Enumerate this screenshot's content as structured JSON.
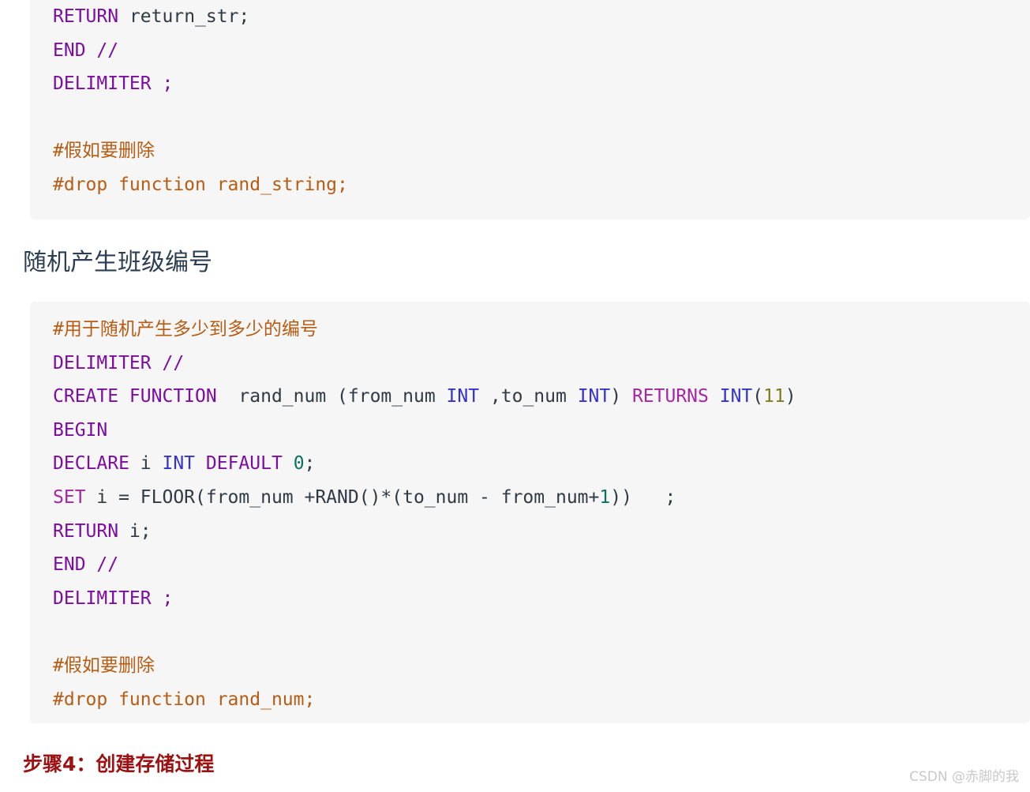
{
  "document": {
    "background_color": "#ffffff",
    "code_block_background": "#f6f6f6",
    "heading_color": "#2c3e50",
    "red_heading_color": "#9c1212",
    "comment_color": "#b85c14",
    "keyword_color": "#7c0da0",
    "type_color": "#3333cc",
    "number_color": "#0b7261",
    "watermark_color": "#c9c9c9"
  },
  "code_block_1": {
    "language": "sql",
    "lines": [
      {
        "tokens": [
          {
            "t": "RETURN",
            "c": "kw"
          },
          {
            "t": " ",
            "c": "plain"
          },
          {
            "t": "return_str;",
            "c": "plain"
          }
        ]
      },
      {
        "tokens": [
          {
            "t": "END",
            "c": "kw"
          },
          {
            "t": " ",
            "c": "plain"
          },
          {
            "t": "//",
            "c": "kw"
          }
        ]
      },
      {
        "tokens": [
          {
            "t": "DELIMITER",
            "c": "kw"
          },
          {
            "t": " ;",
            "c": "kw"
          }
        ]
      },
      {
        "tokens": []
      },
      {
        "tokens": [
          {
            "t": "#假如要删除",
            "c": "cmt"
          }
        ]
      },
      {
        "tokens": [
          {
            "t": "#drop function rand_string;",
            "c": "cmt"
          }
        ]
      }
    ],
    "plain_text": "RETURN return_str;\nEND //\nDELIMITER ;\n\n#假如要删除\n#drop function rand_string;"
  },
  "section_heading": {
    "text": "随机产生班级编号"
  },
  "code_block_2": {
    "language": "sql",
    "lines": [
      {
        "tokens": [
          {
            "t": "#用于随机产生多少到多少的编号",
            "c": "cmt"
          }
        ]
      },
      {
        "tokens": [
          {
            "t": "DELIMITER",
            "c": "kw"
          },
          {
            "t": " //",
            "c": "kw"
          }
        ]
      },
      {
        "tokens": [
          {
            "t": "CREATE FUNCTION",
            "c": "kw"
          },
          {
            "t": "  rand_num (from_num ",
            "c": "plain"
          },
          {
            "t": "INT",
            "c": "type"
          },
          {
            "t": " ,to_num ",
            "c": "plain"
          },
          {
            "t": "INT",
            "c": "type"
          },
          {
            "t": ") ",
            "c": "plain"
          },
          {
            "t": "RETURNS",
            "c": "kw2"
          },
          {
            "t": " ",
            "c": "plain"
          },
          {
            "t": "INT",
            "c": "type"
          },
          {
            "t": "(",
            "c": "plain"
          },
          {
            "t": "11",
            "c": "num2"
          },
          {
            "t": ")",
            "c": "plain"
          }
        ]
      },
      {
        "tokens": [
          {
            "t": "BEGIN",
            "c": "kw"
          }
        ]
      },
      {
        "tokens": [
          {
            "t": "DECLARE",
            "c": "kw"
          },
          {
            "t": " i ",
            "c": "plain"
          },
          {
            "t": "INT",
            "c": "type"
          },
          {
            "t": " ",
            "c": "plain"
          },
          {
            "t": "DEFAULT",
            "c": "kw"
          },
          {
            "t": " ",
            "c": "plain"
          },
          {
            "t": "0",
            "c": "num"
          },
          {
            "t": ";",
            "c": "plain"
          }
        ]
      },
      {
        "tokens": [
          {
            "t": "SET",
            "c": "kw2"
          },
          {
            "t": " i = FLOOR(from_num +RAND()*(to_num - from_num+",
            "c": "plain"
          },
          {
            "t": "1",
            "c": "num"
          },
          {
            "t": "))   ;",
            "c": "plain"
          }
        ]
      },
      {
        "tokens": [
          {
            "t": "RETURN",
            "c": "kw"
          },
          {
            "t": " i;",
            "c": "plain"
          }
        ]
      },
      {
        "tokens": [
          {
            "t": "END",
            "c": "kw"
          },
          {
            "t": " ",
            "c": "plain"
          },
          {
            "t": "//",
            "c": "kw"
          }
        ]
      },
      {
        "tokens": [
          {
            "t": "DELIMITER",
            "c": "kw"
          },
          {
            "t": " ;",
            "c": "kw"
          }
        ]
      },
      {
        "tokens": []
      },
      {
        "tokens": [
          {
            "t": "#假如要删除",
            "c": "cmt"
          }
        ]
      },
      {
        "tokens": [
          {
            "t": "#drop function rand_num;",
            "c": "cmt"
          }
        ]
      }
    ],
    "plain_text": "#用于随机产生多少到多少的编号\nDELIMITER //\nCREATE FUNCTION  rand_num (from_num INT ,to_num INT) RETURNS INT(11)\nBEGIN\nDECLARE i INT DEFAULT 0;\nSET i = FLOOR(from_num +RAND()*(to_num - from_num+1))   ;\nRETURN i;\nEND //\nDELIMITER ;\n\n#假如要删除\n#drop function rand_num;"
  },
  "step_heading": {
    "text": "步骤4：创建存储过程"
  },
  "watermark": {
    "text": "CSDN @赤脚的我"
  }
}
